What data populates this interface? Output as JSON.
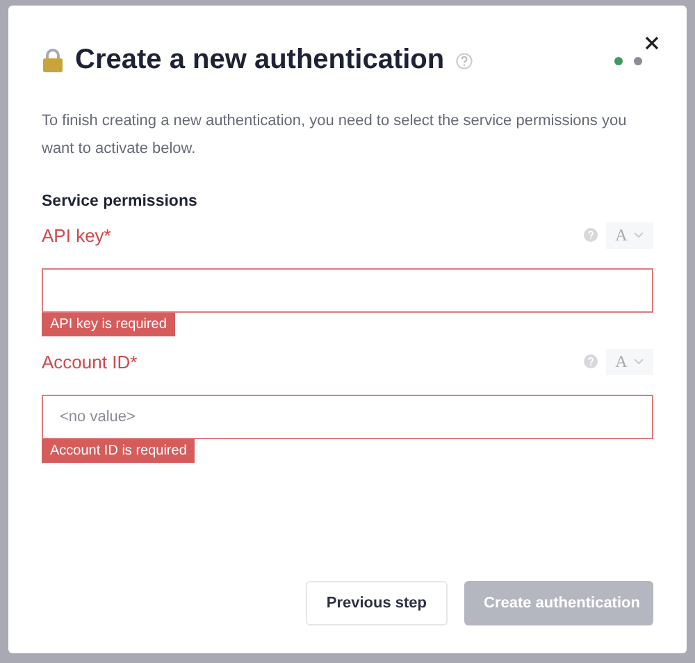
{
  "dialog": {
    "title": "Create a new authentication",
    "steps": [
      {
        "selected": true
      },
      {
        "selected": false
      }
    ],
    "description": "To finish creating a new authentication, you need to select the service permissions you want to activate below."
  },
  "section_title": "Service permissions",
  "fields": [
    {
      "label": "API key*",
      "format": "A",
      "error": "API key is required",
      "invalid": true
    },
    {
      "label": "Account ID*",
      "placeholder": "<no value>",
      "format": "A",
      "error": "Account ID is required",
      "invalid": true
    }
  ],
  "buttons": [
    {
      "label": "Previous step",
      "kind": "secondary",
      "disabled": false
    },
    {
      "label": "Create authentication",
      "kind": "primary",
      "disabled": true
    }
  ]
}
